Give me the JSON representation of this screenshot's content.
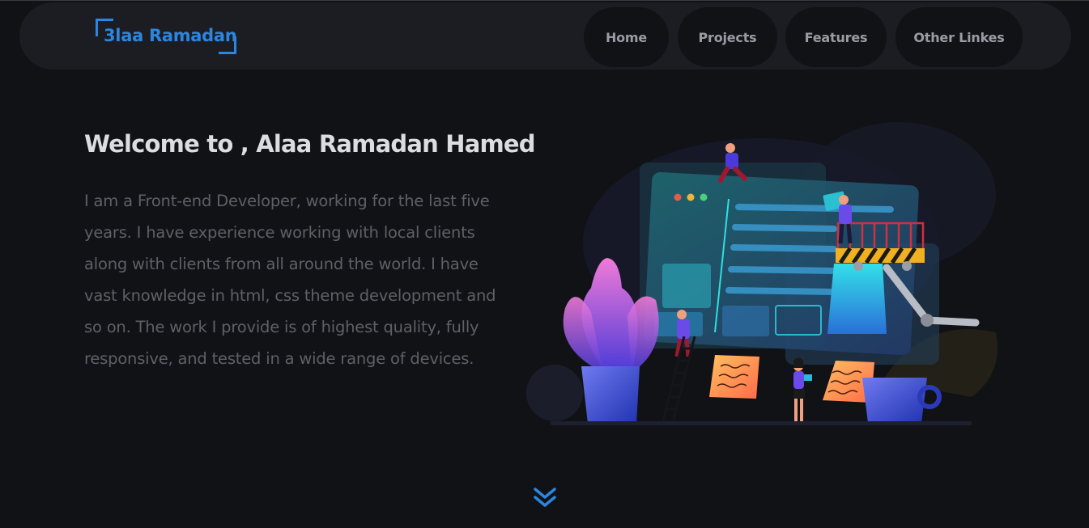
{
  "header": {
    "logo_text": "3laa Ramadan",
    "nav": [
      {
        "label": "Home"
      },
      {
        "label": "Projects"
      },
      {
        "label": "Features"
      },
      {
        "label": "Other Linkes"
      }
    ]
  },
  "hero": {
    "title": "Welcome to , Alaa Ramadan Hamed",
    "description": "I am a Front-end Developer, working for the last five years. I have experience working with local clients along with clients from all around the world. I have vast knowledge in html, css theme development and so on. The work I provide is of highest quality, fully responsive, and tested in a wide range of devices."
  },
  "icons": {
    "scroll": "double-chevron-down-icon",
    "illustration": "developer-team-illustration"
  },
  "colors": {
    "accent": "#2a86e0",
    "background": "#111216",
    "header_bg": "#1c1d22",
    "nav_pill": "#111216",
    "title": "#dcdde0",
    "body_text": "#5e6068"
  }
}
